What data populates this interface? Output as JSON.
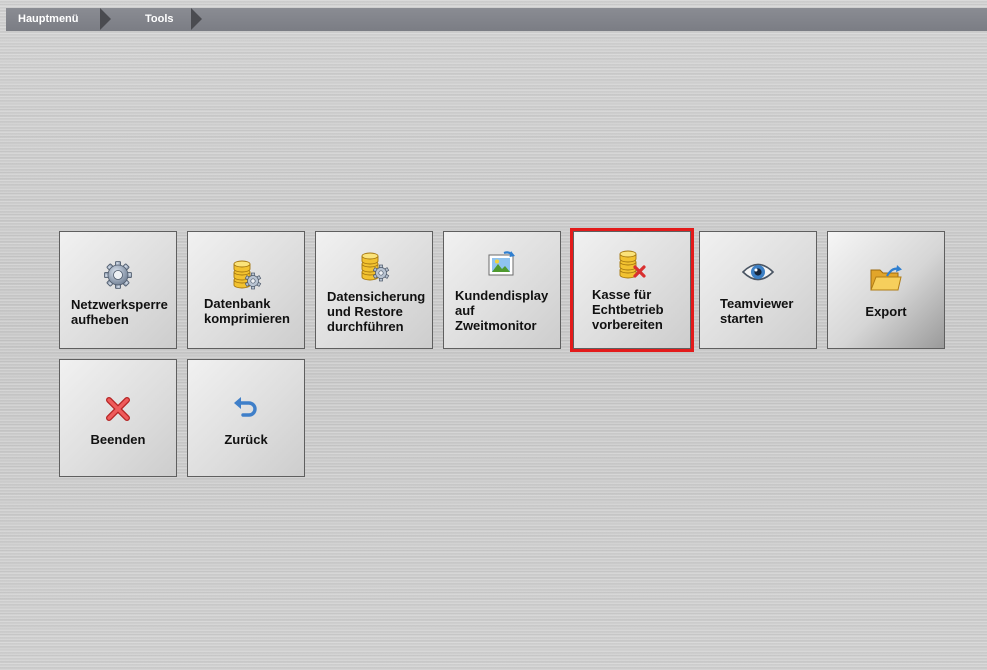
{
  "breadcrumb": {
    "items": [
      "Hauptmenü",
      "Tools"
    ]
  },
  "tiles": [
    {
      "label": "Netzwerksperre\naufheben",
      "icon": "gear-icon"
    },
    {
      "label": "Datenbank\nkomprimieren",
      "icon": "database-gear-icon"
    },
    {
      "label": "Datensicherung\nund Restore\ndurchführen",
      "icon": "database-gear-icon"
    },
    {
      "label": "Kundendisplay\nauf\nZweitmonitor",
      "icon": "monitor-image-icon"
    },
    {
      "label": "Kasse für\nEchtbetrieb\nvorbereiten",
      "icon": "database-delete-icon"
    },
    {
      "label": "Teamviewer\nstarten",
      "icon": "eye-icon"
    },
    {
      "label": "Export",
      "icon": "folder-export-icon"
    },
    {
      "label": "Beenden",
      "icon": "close-x-icon"
    },
    {
      "label": "Zurück",
      "icon": "undo-arrow-icon"
    }
  ],
  "colors": {
    "highlight": "#e31b1b",
    "breadcrumb_bg": "#7f8188"
  }
}
